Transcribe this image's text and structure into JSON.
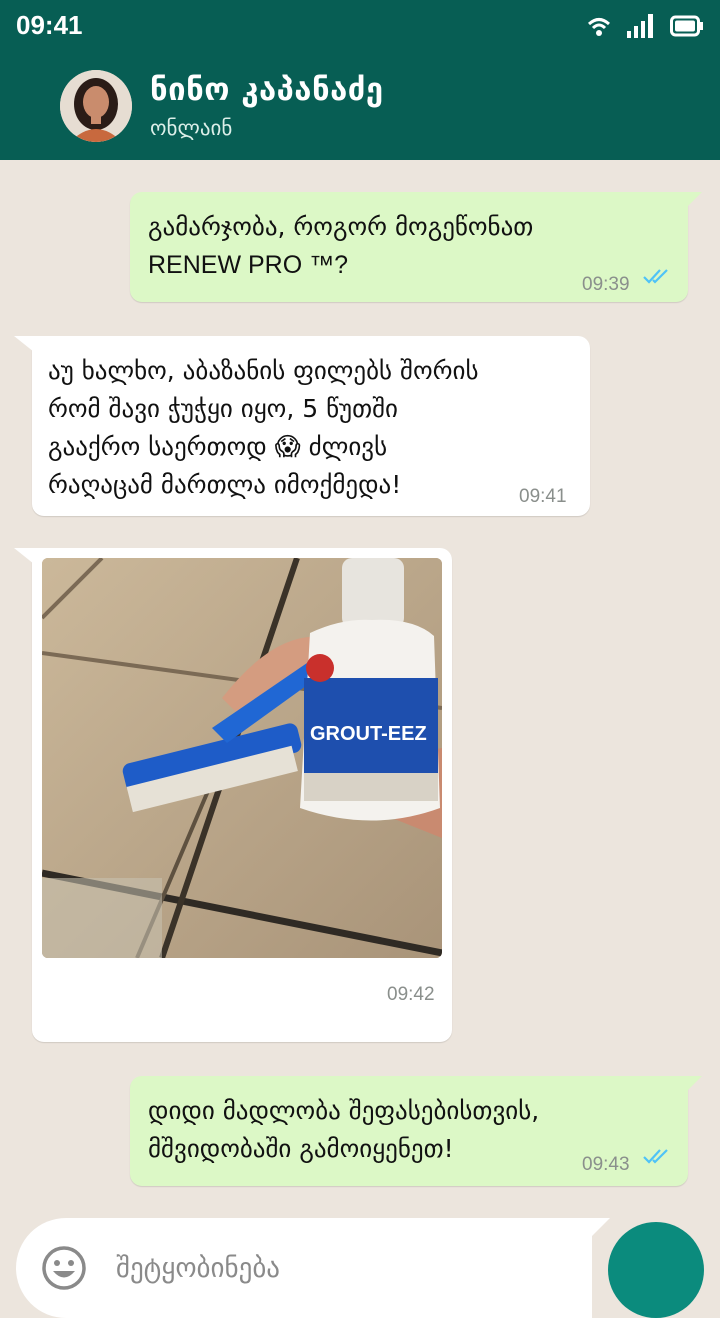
{
  "status_bar": {
    "time": "09:41",
    "icons": [
      "wifi-icon",
      "signal-icon",
      "battery-icon"
    ]
  },
  "header": {
    "contact_name": "ნინო კაპანაძე",
    "contact_status": "ონლაინ",
    "avatar": "profile-photo"
  },
  "messages": [
    {
      "direction": "outgoing",
      "lines": [
        "გამარჯობა, როგორ მოგეწონათ",
        "RENEW PRO ™?"
      ],
      "time": "09:39",
      "read": true
    },
    {
      "direction": "incoming",
      "lines": [
        "აუ ხალხო, აბაზანის ფილებს შორის",
        "რომ შავი ჭუჭყი იყო, 5 წუთში",
        "გააქრო საერთოდ 😱  ძლივს",
        "რაღაცამ მართლა იმოქმედა!"
      ],
      "time": "09:41"
    },
    {
      "direction": "incoming",
      "type": "image",
      "image_label": "GROUT-EEZ",
      "time": "09:42"
    },
    {
      "direction": "outgoing",
      "lines": [
        "დიდი მადლობა შეფასებისთვის,",
        "მშვიდობაში გამოიყენეთ!"
      ],
      "time": "09:43",
      "read": true
    }
  ],
  "composer": {
    "placeholder": "შეტყობინება",
    "emoji_icon": "emoji-icon",
    "send_icon": "send-button"
  },
  "colors": {
    "header_bg": "#075e54",
    "chat_bg": "#ece5dd",
    "outgoing_bubble": "#dcf8c6",
    "incoming_bubble": "#ffffff",
    "read_ticks": "#4fc3f7",
    "send_button": "#0b8b7d"
  }
}
